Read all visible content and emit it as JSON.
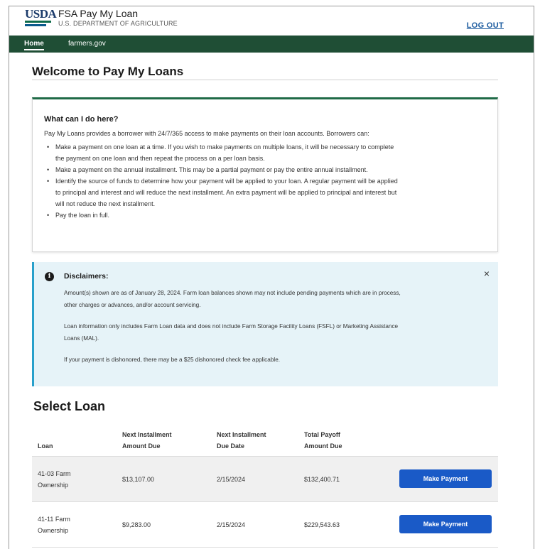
{
  "header": {
    "logo_text": "USDA",
    "title": "FSA Pay My Loan",
    "subtitle": "U.S. DEPARTMENT OF AGRICULTURE",
    "logout_label": "LOG OUT"
  },
  "nav": {
    "items": [
      {
        "label": "Home",
        "active": true
      },
      {
        "label": "farmers.gov",
        "active": false
      }
    ]
  },
  "page": {
    "title": "Welcome to Pay My Loans"
  },
  "info_card": {
    "heading": "What can I do here?",
    "intro": "Pay My Loans provides a borrower with 24/7/365 access to make payments on their loan accounts. Borrowers can:",
    "bullets": [
      {
        "lines": [
          "Make a payment on one loan at a time. If you wish to make payments on multiple loans, it will be necessary to complete",
          "the payment on one loan and then repeat the process on a per loan basis."
        ]
      },
      {
        "lines": [
          "Make a payment on the annual installment. This may be a partial payment or pay the entire annual installment."
        ]
      },
      {
        "lines": [
          "Identify the source of funds to determine how your payment will be applied to your loan. A regular payment will be applied",
          "to principal and interest and will reduce the next installment. An extra payment will be applied to principal and interest but",
          "will not reduce the next installment."
        ]
      },
      {
        "lines": [
          "Pay the loan in full."
        ]
      }
    ]
  },
  "disclaimer": {
    "heading": "Disclaimers:",
    "paragraphs": [
      {
        "lines": [
          "Amount(s) shown are as of January 28, 2024. Farm loan balances shown may not include pending payments which are in process,",
          "other charges or advances, and/or account servicing."
        ]
      },
      {
        "lines": [
          "Loan information only includes Farm Loan data and does not include Farm Storage Facility Loans (FSFL) or Marketing Assistance",
          "Loans (MAL)."
        ]
      },
      {
        "lines": [
          "If your payment is dishonored, there may be a $25 dishonored check fee applicable."
        ]
      }
    ],
    "close_glyph": "×"
  },
  "select_loan": {
    "title": "Select Loan",
    "columns": [
      {
        "lines": [
          "Loan"
        ]
      },
      {
        "lines": [
          "Next Installment",
          "Amount Due"
        ]
      },
      {
        "lines": [
          "Next Installment",
          "Due Date"
        ]
      },
      {
        "lines": [
          "Total Payoff",
          "Amount Due"
        ]
      }
    ],
    "rows": [
      {
        "loan": [
          "41-03 Farm",
          "Ownership"
        ],
        "amount_due": "$13,107.00",
        "due_date": "2/15/2024",
        "payoff": "$132,400.71",
        "button": "Make Payment"
      },
      {
        "loan": [
          "41-11 Farm",
          "Ownership"
        ],
        "amount_due": "$9,283.00",
        "due_date": "2/15/2024",
        "payoff": "$229,543.63",
        "button": "Make Payment"
      }
    ]
  },
  "colors": {
    "nav_green": "#1f4e35",
    "card_accent": "#1f6b47",
    "disclaimer_bg": "#e6f3f8",
    "disclaimer_border": "#28a0cb",
    "button_blue": "#1a5ac7",
    "link_blue": "#1a5a9e"
  },
  "icons": {
    "info": "info-icon",
    "close": "close-icon"
  }
}
